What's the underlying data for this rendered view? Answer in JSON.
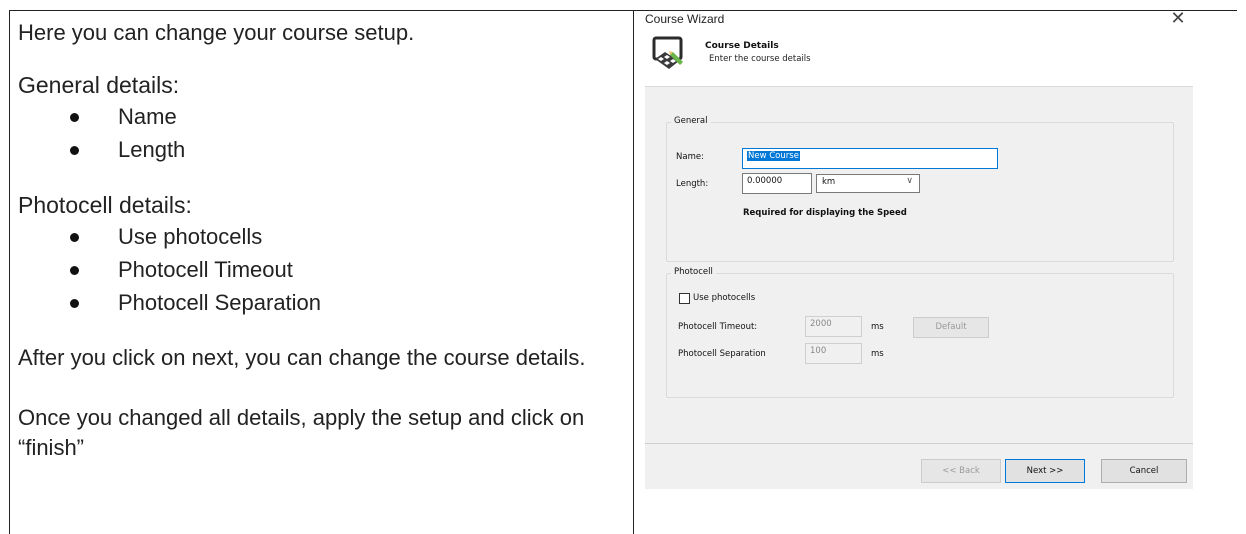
{
  "document": {
    "intro": "Here you can change your course setup.",
    "general_heading": "General details:",
    "general_items": [
      "Name",
      "Length"
    ],
    "photocell_heading": "Photocell details:",
    "photocell_items": [
      "Use photocells",
      "Photocell Timeout",
      "Photocell Separation"
    ],
    "next_note": "After you click on next, you can change the course details.",
    "finish_note": "Once you changed all details, apply the setup and click on “finish”"
  },
  "dialog": {
    "title": "Course Wizard",
    "close_glyph": "✕",
    "header": {
      "title": "Course Details",
      "subtitle": "Enter the course details",
      "icon": "course-wizard-icon"
    },
    "general_group": {
      "label": "General",
      "name_label": "Name:",
      "name_value": "New Course",
      "length_label": "Length:",
      "length_value": "0.00000",
      "unit_value": "km",
      "unit_chevron": "∨",
      "required_note": "Required for displaying the Speed"
    },
    "photocell_group": {
      "label": "Photocell",
      "use_photocells_label": "Use photocells",
      "use_photocells_checked": false,
      "timeout_label": "Photocell Timeout:",
      "timeout_value": "2000",
      "timeout_unit": "ms",
      "default_button": "Default",
      "separation_label": "Photocell Separation",
      "separation_value": "100",
      "separation_unit": "ms"
    },
    "footer": {
      "back_button": "<< Back",
      "next_button": "Next >>",
      "cancel_button": "Cancel"
    },
    "colors": {
      "selection": "#0078d7",
      "panel": "#f0f0f0"
    }
  }
}
